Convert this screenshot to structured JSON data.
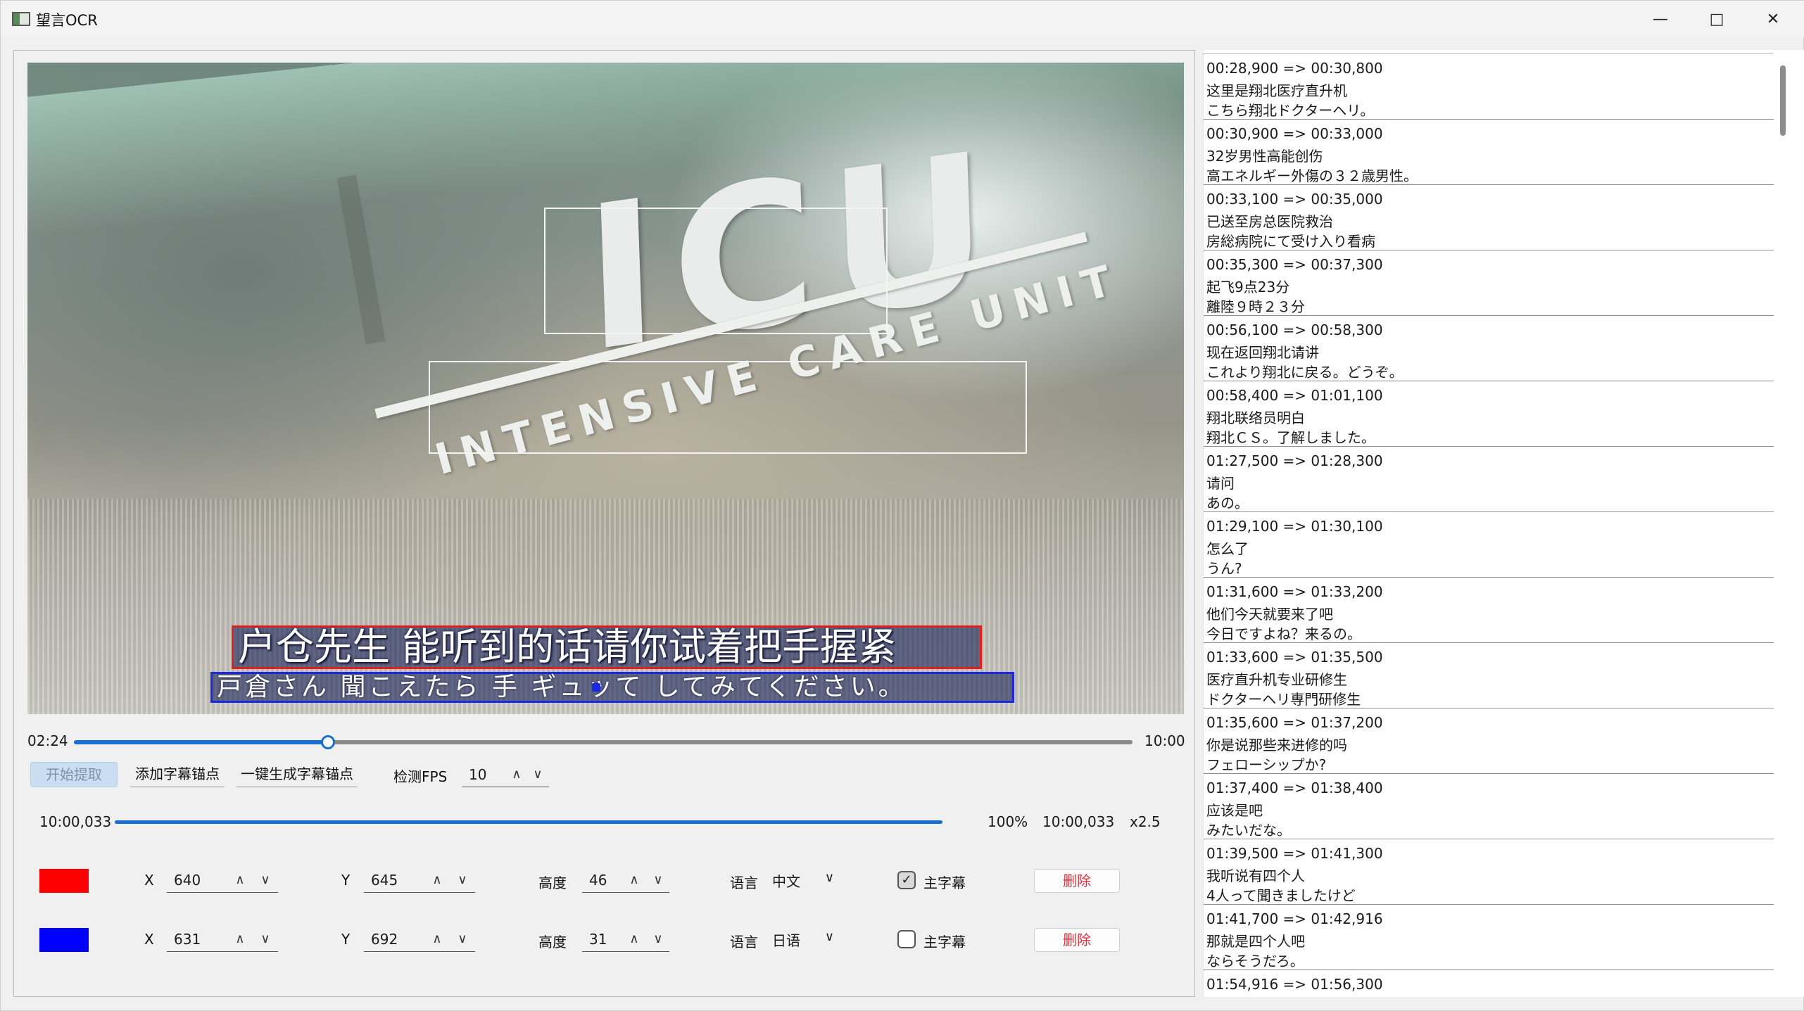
{
  "window": {
    "title": "望言OCR",
    "min_icon": "minimize-icon",
    "max_icon": "maximize-icon",
    "close_icon": "close-icon"
  },
  "video": {
    "logo_main": "ICU",
    "logo_sub": "INTENSIVE CARE UNIT",
    "subtitle_cn": "户仓先生 能听到的话请你试着把手握紧",
    "subtitle_jp": "戸倉さん 聞こえたら 手 ギュッて してみてください。"
  },
  "timeline": {
    "current": "02:24",
    "total": "10:00",
    "progress": 0.24
  },
  "toolbar": {
    "start_label": "开始提取",
    "add_anchor_label": "添加字幕锚点",
    "gen_anchor_label": "一键生成字幕锚点",
    "fps_label": "检测FPS",
    "fps_value": "10"
  },
  "progress": {
    "elapsed": "10:00,033",
    "percent": "100%",
    "total": "10:00,033",
    "speed": "x2.5"
  },
  "anchors": [
    {
      "color": "#ff0000",
      "x_label": "X",
      "x": "640",
      "y_label": "Y",
      "y": "645",
      "h_label": "高度",
      "h": "46",
      "lang_label": "语言",
      "lang": "中文",
      "main_label": "主字幕",
      "main": true,
      "delete_label": "删除"
    },
    {
      "color": "#0000ff",
      "x_label": "X",
      "x": "631",
      "y_label": "Y",
      "y": "692",
      "h_label": "高度",
      "h": "31",
      "lang_label": "语言",
      "lang": "日语",
      "main_label": "主字幕",
      "main": false,
      "delete_label": "删除"
    }
  ],
  "subtitles": [
    {
      "time": "00:28,900  =>  00:30,800",
      "cn": "这里是翔北医疗直升机",
      "jp": "こちら翔北ドクターヘリ。"
    },
    {
      "time": "00:30,900  =>  00:33,000",
      "cn": "32岁男性高能创伤",
      "jp": "高エネルギー外傷の３２歳男性。"
    },
    {
      "time": "00:33,100  =>  00:35,000",
      "cn": "已送至房总医院救治",
      "jp": "房総病院にて受け入り看病"
    },
    {
      "time": "00:35,300  =>  00:37,300",
      "cn": "起飞9点23分",
      "jp": "離陸９時２３分"
    },
    {
      "time": "00:56,100  =>  00:58,300",
      "cn": "现在返回翔北请讲",
      "jp": "これより翔北に戻る。どうぞ。"
    },
    {
      "time": "00:58,400  =>  01:01,100",
      "cn": "翔北联络员明白",
      "jp": "翔北ＣＳ。了解しました。"
    },
    {
      "time": "01:27,500  =>  01:28,300",
      "cn": "请问",
      "jp": "あの。"
    },
    {
      "time": "01:29,100  =>  01:30,100",
      "cn": "怎么了",
      "jp": "うん?"
    },
    {
      "time": "01:31,600  =>  01:33,200",
      "cn": "他们今天就要来了吧",
      "jp": "今日ですよね？来るの。"
    },
    {
      "time": "01:33,600  =>  01:35,500",
      "cn": "医疗直升机专业研修生",
      "jp": "ドクターヘリ専門研修生"
    },
    {
      "time": "01:35,600  =>  01:37,200",
      "cn": "你是说那些来进修的吗",
      "jp": "フェローシップか?"
    },
    {
      "time": "01:37,400  =>  01:38,400",
      "cn": "应该是吧",
      "jp": "みたいだな。"
    },
    {
      "time": "01:39,500  =>  01:41,300",
      "cn": "我听说有四个人",
      "jp": "4人って聞きましたけど"
    },
    {
      "time": "01:41,700  =>  01:42,916",
      "cn": "那就是四个人吧",
      "jp": "ならそうだろ。"
    },
    {
      "time": "01:54,916  =>  01:56,300",
      "cn": "",
      "jp": ""
    }
  ]
}
